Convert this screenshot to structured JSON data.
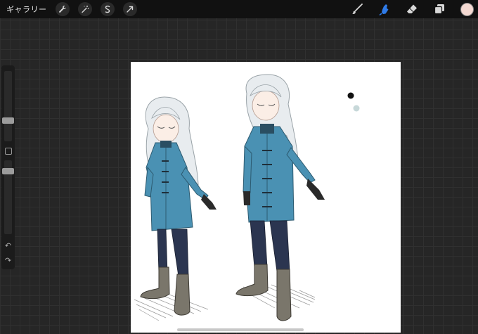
{
  "toolbar": {
    "gallery_label": "ギャラリー",
    "left_tools": [
      "wrench-icon",
      "magic-wand-icon",
      "selection-icon",
      "transform-arrow-icon"
    ],
    "right_tools": [
      "brush-icon",
      "smudge-icon",
      "eraser-icon",
      "layers-icon"
    ],
    "active_tool": "smudge-icon",
    "active_color": "#f4d9d2",
    "tool_color_inactive": "#d8d8d8",
    "tool_color_active": "#2f7be8"
  },
  "sidebar": {
    "undo_symbol": "↶",
    "redo_symbol": "↷"
  },
  "artwork": {
    "palette_swatches": [
      "#111111",
      "#c7d8d9"
    ],
    "coat_color": "#4a91b3",
    "pants_color": "#2b3550",
    "boot_color": "#7a766b",
    "hair_color": "#e8ecef"
  }
}
